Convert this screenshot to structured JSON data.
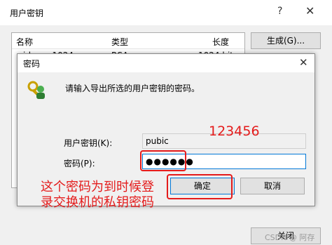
{
  "outer_dialog": {
    "title": "用户密钥",
    "help_glyph": "?",
    "close_glyph": "✕",
    "columns": [
      "名称",
      "类型",
      "长度"
    ],
    "rows": [
      {
        "name": "id_rsa_1024",
        "type": "RSA",
        "length": "1024 bits"
      }
    ],
    "generate_button": "生成(G)...",
    "close_button": "关闭"
  },
  "password_dialog": {
    "title": "密码",
    "close_glyph": "✕",
    "prompt": "请输入导出所选的用户密钥的密码。",
    "user_key_label": "用户密钥(K):",
    "user_key_value": "pubic",
    "password_label": "密码(P):",
    "password_value": "●●●●●●",
    "ok_button": "确定",
    "cancel_button": "取消"
  },
  "annotations": {
    "password_note": "123456",
    "caption_line1": "这个密码为到时候登",
    "caption_line2": "录交换机的私钥密码"
  },
  "watermark": "CSDN @ 阿存",
  "colors": {
    "annotation": "#e41b1b",
    "focus": "#0078d7"
  }
}
